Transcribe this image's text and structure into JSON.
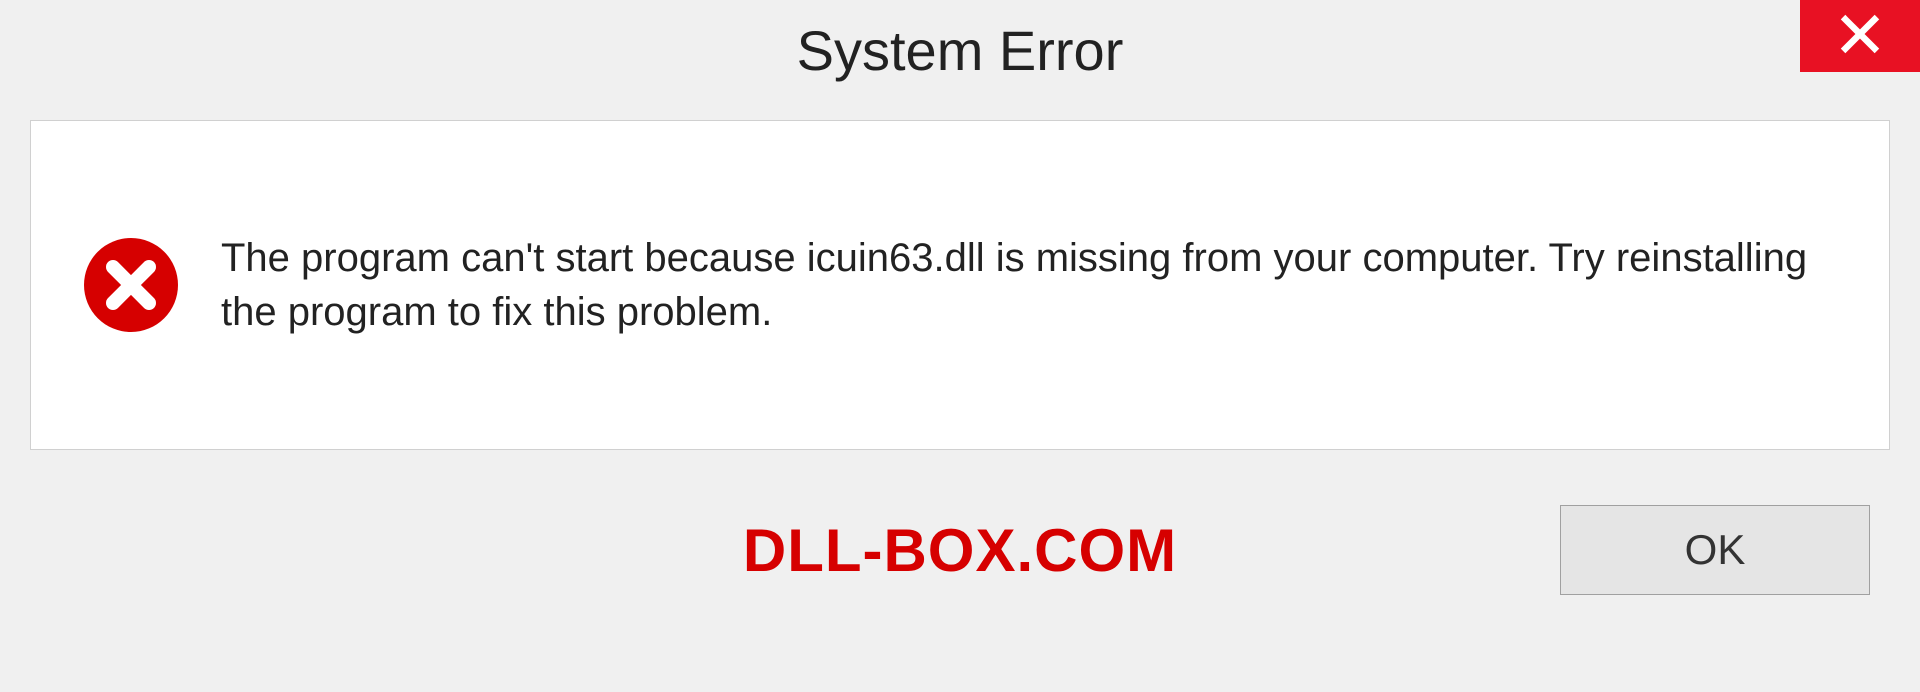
{
  "dialog": {
    "title": "System Error",
    "message": "The program can't start because icuin63.dll is missing from your computer. Try reinstalling the program to fix this problem.",
    "ok_label": "OK"
  },
  "watermark": "DLL-BOX.COM",
  "colors": {
    "close_bg": "#e81123",
    "error_red": "#d60000"
  }
}
